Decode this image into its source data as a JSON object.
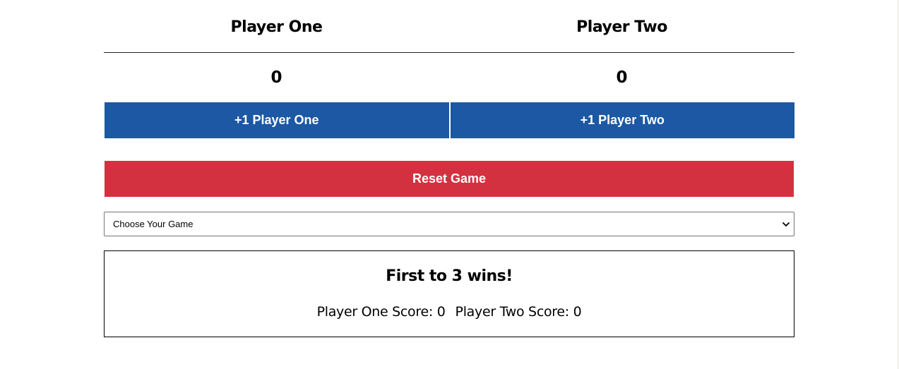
{
  "players": [
    {
      "name": "Player One",
      "score": "0",
      "button_label": "+1 Player One"
    },
    {
      "name": "Player Two",
      "score": "0",
      "button_label": "+1 Player Two"
    }
  ],
  "reset_label": "Reset Game",
  "game_select": {
    "selected": "Choose Your Game"
  },
  "info": {
    "title": "First to 3 wins!",
    "p1_label": "Player One Score:",
    "p1_score": "0",
    "p2_label": "Player Two Score:",
    "p2_score": "0"
  },
  "colors": {
    "player_button": "#1c58a4",
    "reset_button": "#d43140"
  },
  "icons": {
    "select_arrow": "chevron-down-icon"
  }
}
